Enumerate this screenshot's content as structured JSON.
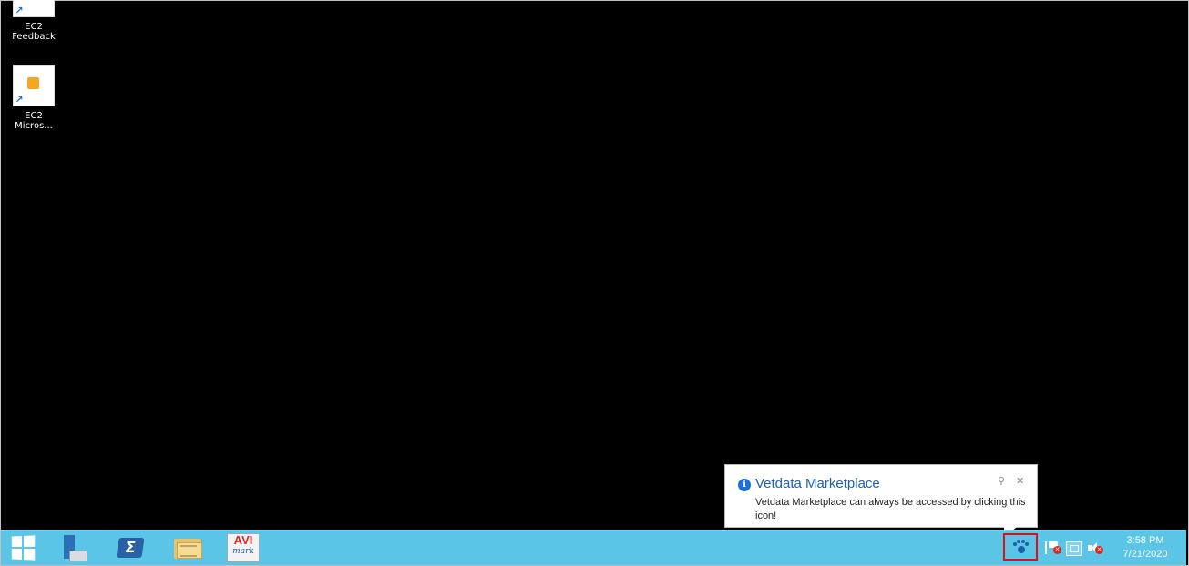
{
  "desktop": {
    "icons": [
      {
        "label_line1": "EC2",
        "label_line2": "Feedback"
      },
      {
        "label_line1": "EC2",
        "label_line2": "Micros..."
      }
    ]
  },
  "taskbar": {
    "pinned": [
      {
        "icon": "windows-start-icon"
      },
      {
        "icon": "server-manager-icon"
      },
      {
        "icon": "powershell-icon",
        "glyph": "Σ"
      },
      {
        "icon": "file-explorer-icon"
      },
      {
        "icon": "avimark-icon",
        "text_line1": "AVI",
        "text_line2": "mark"
      }
    ],
    "tray": {
      "highlighted_icon": "vetdata-paw-icon",
      "icons": [
        "action-center-flag-icon",
        "network-icon",
        "volume-muted-icon"
      ],
      "time": "3:58 PM",
      "date": "7/21/2020"
    }
  },
  "notification": {
    "title": "Vetdata Marketplace",
    "body": "Vetdata Marketplace can always be accessed by clicking this icon!",
    "info_glyph": "i",
    "close_glyph": "✕",
    "options_glyph": "⚲",
    "highlight_color": "#e01010"
  },
  "colors": {
    "taskbar": "#5bc5e8",
    "desktop": "#000000",
    "title": "#1f5fb0"
  }
}
